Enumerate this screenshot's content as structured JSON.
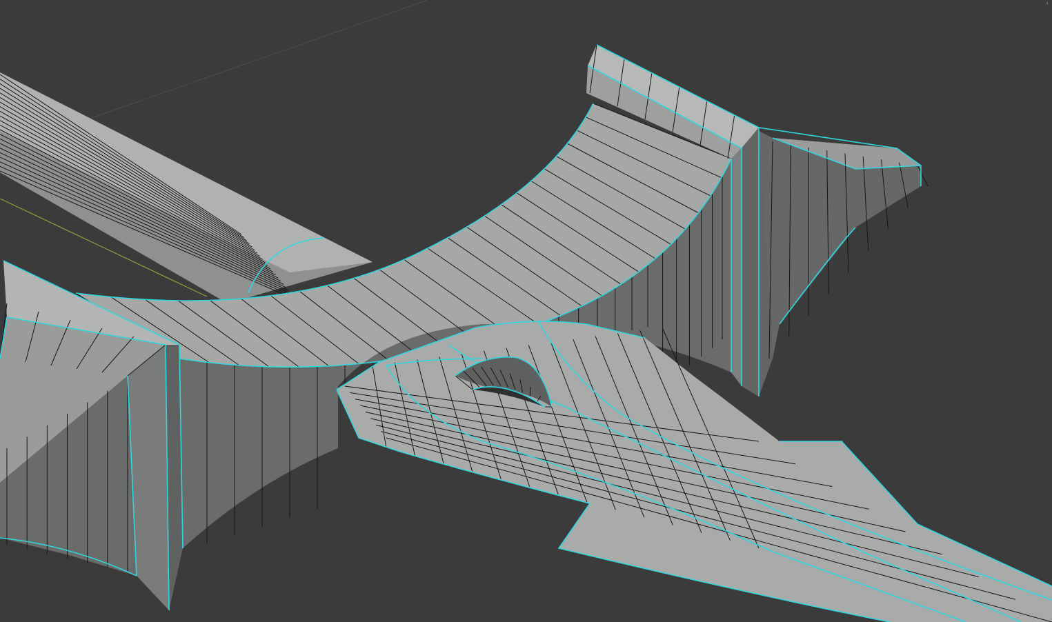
{
  "app": "3D viewport",
  "viewport": {
    "shading": "solid",
    "wireframe_overlay": true,
    "corner_toggle_icon": "chevron-left-icon",
    "corner_toggle_glyph": "‹"
  },
  "colors": {
    "background": "#3b3b3b",
    "grid_line": "#4a4a4a",
    "axis_x": "#8fa33b",
    "seam_edge": "#30d6dd",
    "wire_edge": "#151515",
    "face_light": "#a7a9a9",
    "face_mid": "#8a8c8c",
    "face_dark": "#5c5e5e"
  }
}
